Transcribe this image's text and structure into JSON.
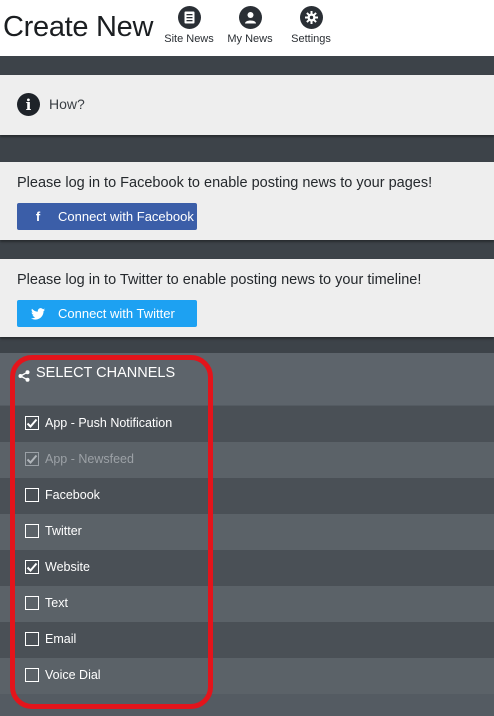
{
  "header": {
    "title": "Create New",
    "nav": [
      {
        "label": "Site News",
        "icon": "news-icon"
      },
      {
        "label": "My News",
        "icon": "user-icon"
      },
      {
        "label": "Settings",
        "icon": "gear-icon"
      }
    ]
  },
  "how": {
    "label": "How?",
    "icon": "info-icon"
  },
  "facebook": {
    "message": "Please log in to Facebook to enable posting news to your pages!",
    "button_label": "Connect with Facebook",
    "color": "#3b5ea8"
  },
  "twitter": {
    "message": "Please log in to Twitter to enable posting news to your timeline!",
    "button_label": "Connect with Twitter",
    "color": "#1da1f2"
  },
  "channels": {
    "title": "SELECT CHANNELS",
    "icon": "share-icon",
    "items": [
      {
        "label": "App - Push Notification",
        "checked": true,
        "disabled": false
      },
      {
        "label": "App - Newsfeed",
        "checked": true,
        "disabled": true
      },
      {
        "label": "Facebook",
        "checked": false,
        "disabled": false
      },
      {
        "label": "Twitter",
        "checked": false,
        "disabled": false
      },
      {
        "label": "Website",
        "checked": true,
        "disabled": false
      },
      {
        "label": "Text",
        "checked": false,
        "disabled": false
      },
      {
        "label": "Email",
        "checked": false,
        "disabled": false
      },
      {
        "label": "Voice Dial",
        "checked": false,
        "disabled": false
      }
    ]
  },
  "colors": {
    "highlight": "#e3141b",
    "panel": "#545b62"
  }
}
